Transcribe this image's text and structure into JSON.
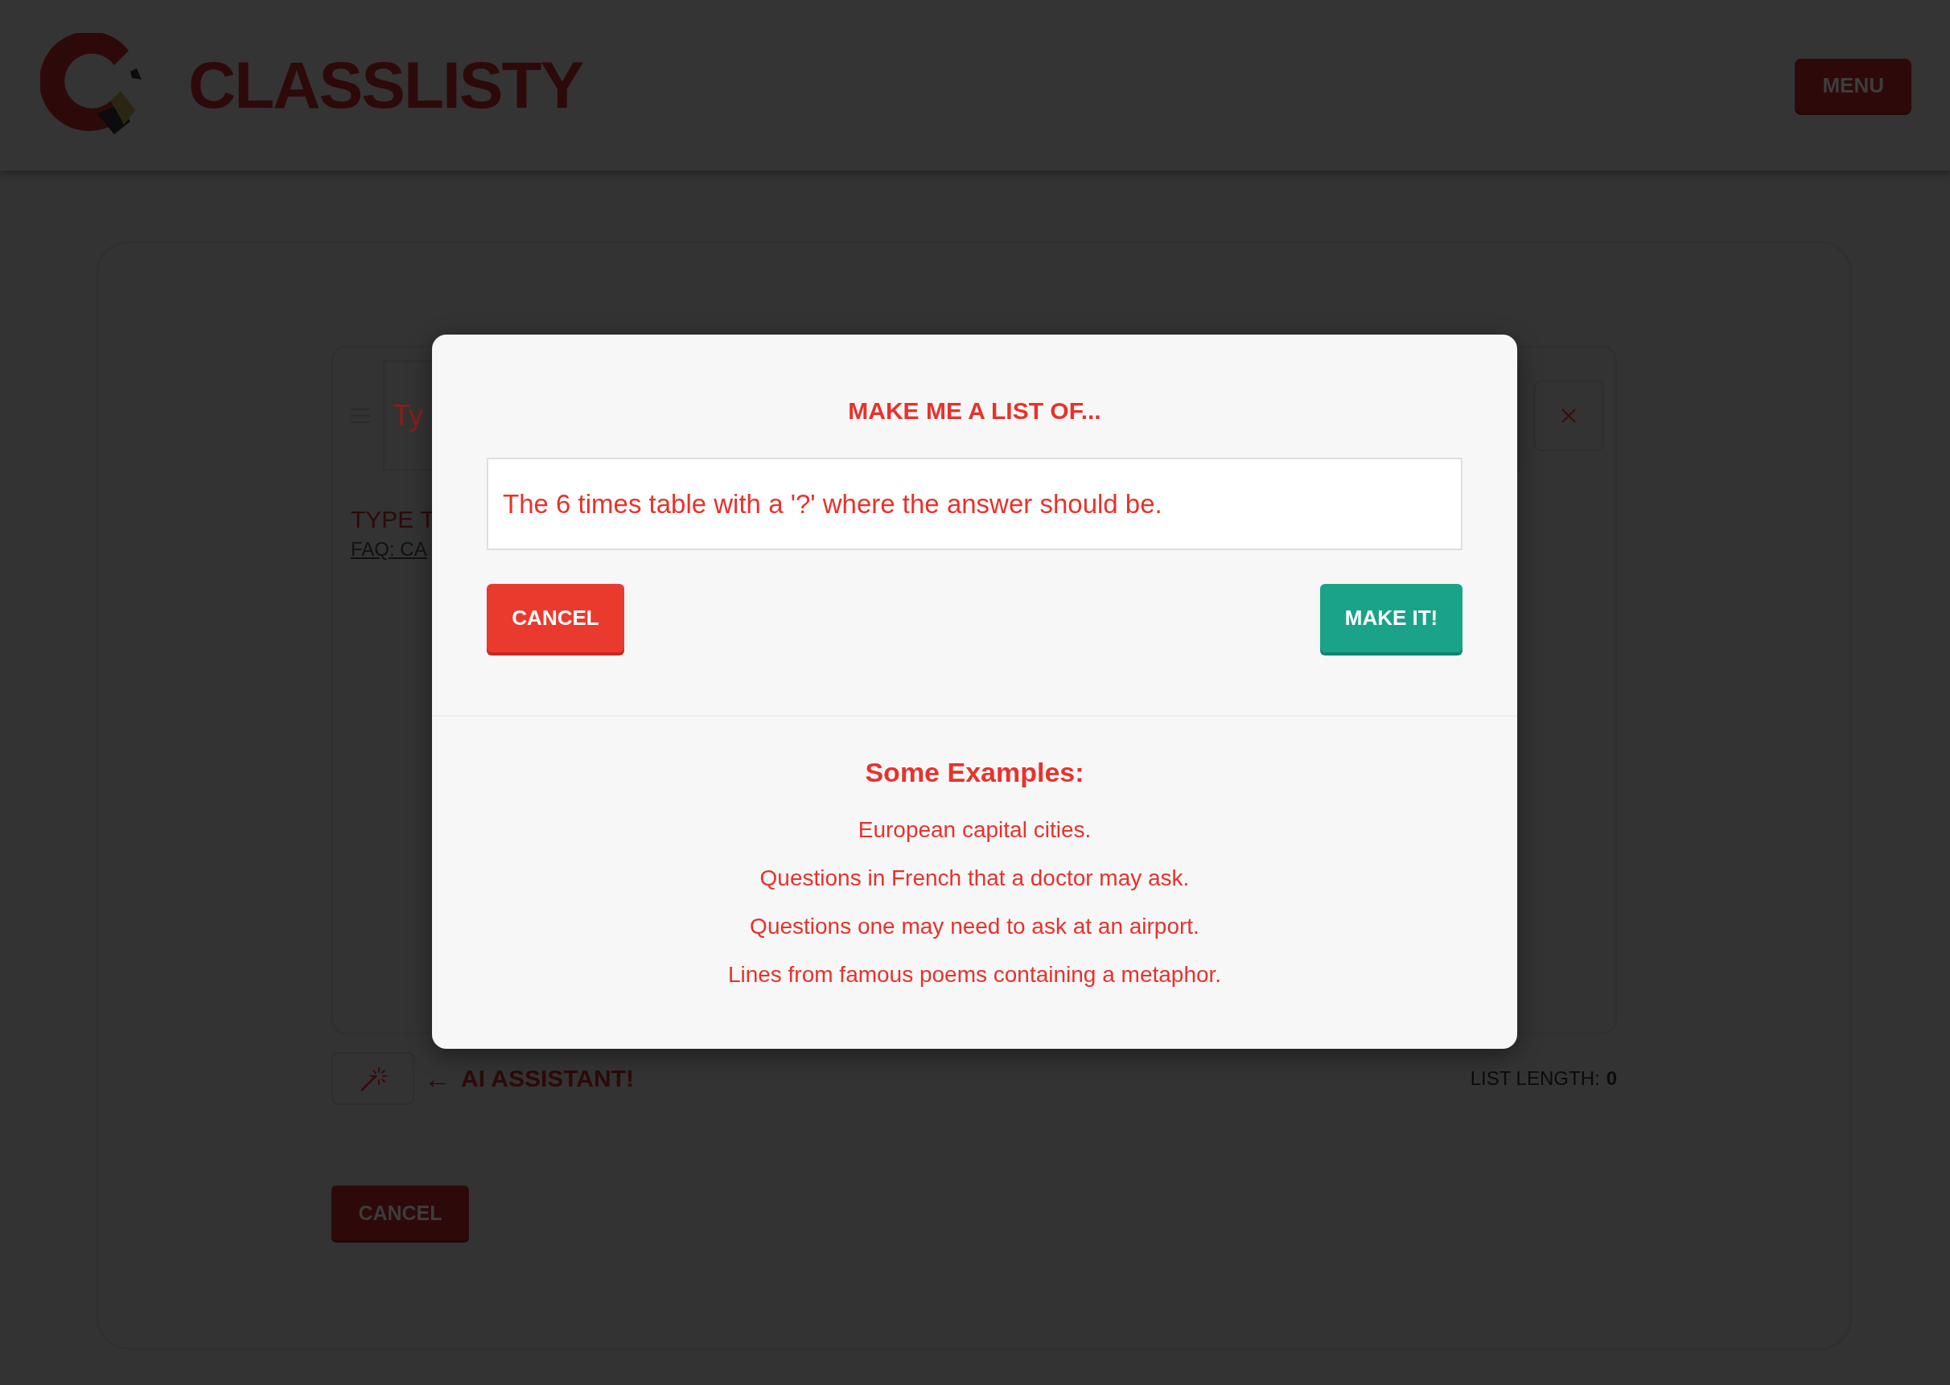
{
  "header": {
    "brand": "CLASSLISTY",
    "menu_button": "MENU"
  },
  "editor": {
    "row_placeholder": "Ty",
    "hint": "TYPE T",
    "faq_link": "FAQ: CA",
    "arrow": "←",
    "ai_label": "AI ASSISTANT!",
    "list_length_label": "LIST LENGTH:",
    "list_length": "0",
    "cancel_button": "CANCEL"
  },
  "dialog": {
    "title": "MAKE ME A LIST OF...",
    "prompt_value": "The 6 times table with a '?' where the answer should be.",
    "cancel_button": "CANCEL",
    "submit_button": "MAKE IT!",
    "examples_title": "Some Examples:",
    "examples": [
      "European capital cities.",
      "Questions in French that a doctor may ask.",
      "Questions one may need to ask at an airport.",
      "Lines from famous poems containing a metaphor."
    ]
  }
}
